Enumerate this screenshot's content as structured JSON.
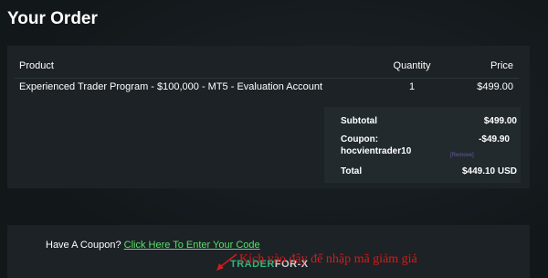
{
  "page": {
    "title": "Your Order"
  },
  "table": {
    "headers": {
      "product": "Product",
      "quantity": "Quantity",
      "price": "Price"
    },
    "rows": [
      {
        "product": "Experienced Trader Program - $100,000 - MT5 - Evaluation Account",
        "quantity": "1",
        "price": "$499.00"
      }
    ]
  },
  "summary": {
    "subtotal_label": "Subtotal",
    "subtotal_value": "$499.00",
    "coupon_label": "Coupon:",
    "coupon_code": "hocvientrader10",
    "coupon_value": "-$49.90",
    "remove_label": "[Remove]",
    "total_label": "Total",
    "total_value": "$449.10 USD"
  },
  "coupon": {
    "prompt": "Have A Coupon?",
    "link_text": "Click Here To Enter Your Code"
  },
  "annotation": {
    "text": "Kích vào đây để nhập mã giảm giá",
    "color": "#d81a1a"
  },
  "watermark": {
    "part1": "TRADER",
    "part2": "FOR-X"
  },
  "colors": {
    "link": "#58e06a",
    "panel": "#1c2226",
    "summary_panel": "#222a2e"
  }
}
